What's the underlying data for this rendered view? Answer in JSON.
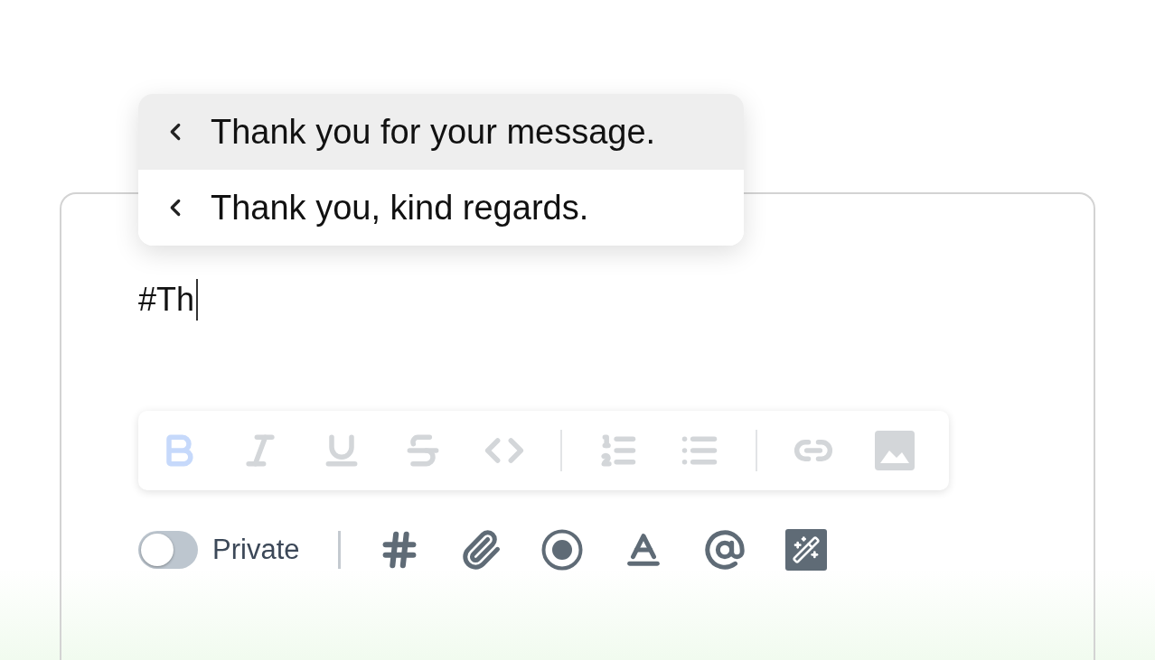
{
  "suggestions": [
    {
      "text": "Thank you for your message.",
      "selected": true
    },
    {
      "text": "Thank you, kind regards.",
      "selected": false
    }
  ],
  "editor": {
    "value": "#Th"
  },
  "format_toolbar": [
    {
      "kind": "bold",
      "active": true
    },
    {
      "kind": "italic",
      "active": false
    },
    {
      "kind": "underline",
      "active": false
    },
    {
      "kind": "strikethrough",
      "active": false
    },
    {
      "kind": "code",
      "active": false
    },
    {
      "kind": "separator"
    },
    {
      "kind": "ordered-list",
      "active": false
    },
    {
      "kind": "bullet-list",
      "active": false
    },
    {
      "kind": "separator"
    },
    {
      "kind": "link",
      "active": false
    },
    {
      "kind": "image",
      "active": false
    }
  ],
  "private_toggle": {
    "label": "Private",
    "on": false
  },
  "actions": [
    {
      "kind": "hashtag"
    },
    {
      "kind": "attachment"
    },
    {
      "kind": "record"
    },
    {
      "kind": "text-color"
    },
    {
      "kind": "mention"
    },
    {
      "kind": "magic"
    }
  ]
}
